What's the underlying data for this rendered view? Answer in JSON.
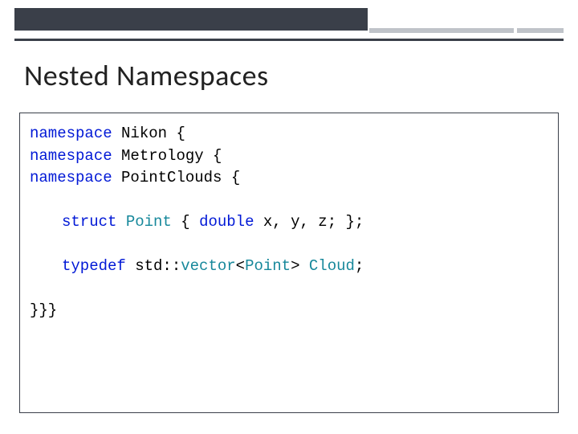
{
  "slide": {
    "title": "Nested Namespaces"
  },
  "code": {
    "kw_namespace": "namespace",
    "ns1": " Nikon {",
    "ns2": " Metrology {",
    "ns3": " PointClouds {",
    "kw_struct": "struct",
    "sp": " ",
    "type_point": "Point",
    "struct_open": " { ",
    "kw_double": "double",
    "struct_body": " x, y, z; };",
    "kw_typedef": "typedef",
    "std_vec": " std::",
    "type_vector": "vector",
    "lt": "<",
    "gt": "> ",
    "type_cloud": "Cloud",
    "semi": ";",
    "close": "}}}"
  }
}
